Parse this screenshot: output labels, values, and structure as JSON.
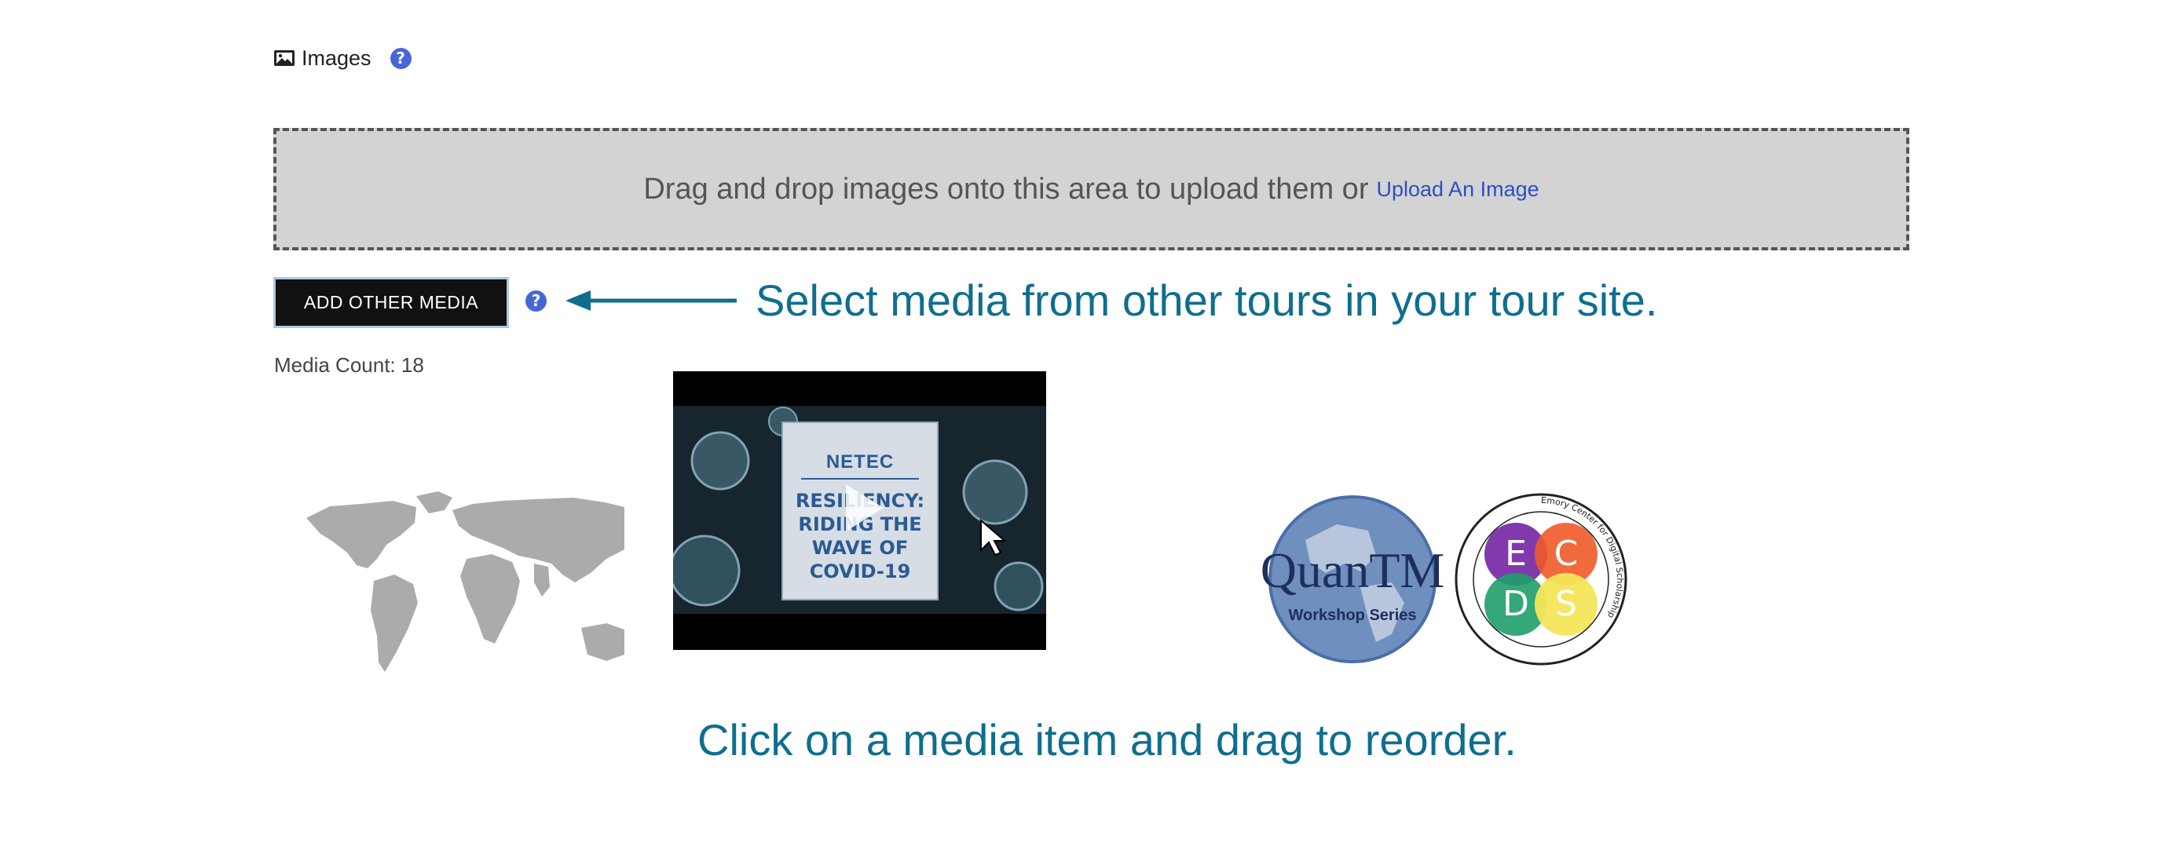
{
  "section": {
    "title": "Images",
    "help_glyph": "?"
  },
  "dropzone": {
    "message": "Drag and drop images onto this area to upload them or",
    "link_label": "Upload An Image"
  },
  "add_media_button": {
    "label": "ADD OTHER MEDIA"
  },
  "annotations": {
    "select_media": "Select media from other tours in your tour site.",
    "reorder": "Click on a media item and drag to reorder."
  },
  "media": {
    "count_label": "Media Count: 18",
    "items": [
      {
        "kind": "image",
        "description_icon": "world-map-icon"
      },
      {
        "kind": "video",
        "brand": "NETEC",
        "title": "RESILIENCY:\nRIDING THE\nWAVE OF\nCOVID-19"
      },
      {
        "kind": "image",
        "logo1_text": "QuanTM",
        "logo1_subtitle": "Workshop Series",
        "logo2_letters": [
          "E",
          "C",
          "D",
          "S"
        ],
        "logo2_ring_text": "Emory Center for Digital Scholarship"
      }
    ]
  },
  "colors": {
    "annotation": "#0f6e8e",
    "help_icon": "#4766d6",
    "dropzone_bg": "#d3d3d3",
    "button_bg": "#111111",
    "link": "#2d4fc4"
  }
}
